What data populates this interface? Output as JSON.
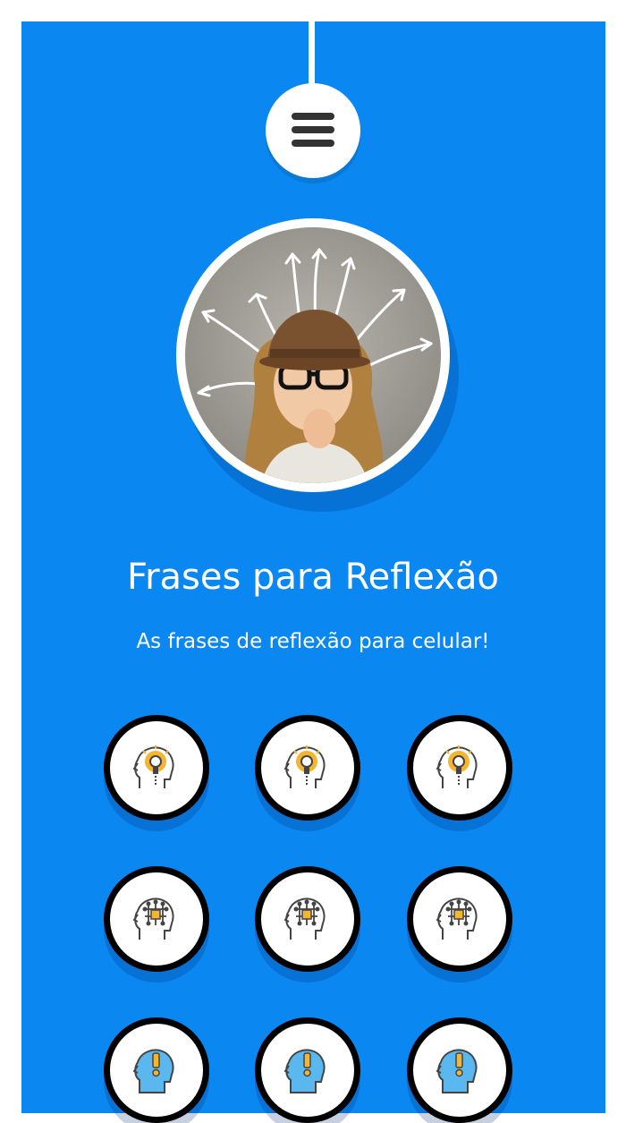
{
  "header": {
    "menu_icon": "hamburger-menu-icon"
  },
  "hero": {
    "image_subject": "girl-thinking-photo",
    "title": "Frases para Reflexão",
    "subtitle": "As frases de reflexão para celular!"
  },
  "colors": {
    "background": "#0a87f0",
    "button_fill": "#ffffff",
    "button_border": "#000000",
    "bulb": "#f5b52e",
    "head_blue": "#5bb8ee"
  },
  "grid": {
    "rows": [
      [
        "lightbulb-head-icon",
        "lightbulb-head-icon",
        "lightbulb-head-icon"
      ],
      [
        "brain-circuit-head-icon",
        "brain-circuit-head-icon",
        "brain-circuit-head-icon"
      ],
      [
        "exclamation-head-icon",
        "exclamation-head-icon",
        "exclamation-head-icon"
      ]
    ]
  }
}
